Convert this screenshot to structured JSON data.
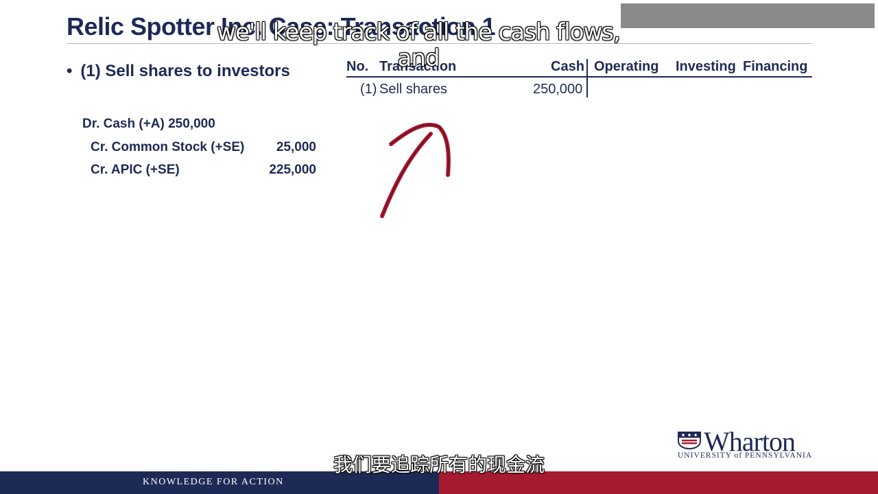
{
  "slide": {
    "title": "Relic Spotter Inc. Case: Transaction 1",
    "bullet": "(1) Sell shares to investors",
    "bullet_marker": "•"
  },
  "journal_entry": {
    "debit_label": "Dr. Cash (+A) 250,000",
    "credit_1_label": "Cr. Common Stock (+SE)",
    "credit_1_amount": "25,000",
    "credit_2_label": "Cr. APIC (+SE)",
    "credit_2_amount": "225,000"
  },
  "cash_flow_table": {
    "headers": {
      "no": "No.",
      "transaction": "Transaction",
      "cash": "Cash",
      "operating": "Operating",
      "investing": "Investing",
      "financing": "Financing"
    },
    "rows": [
      {
        "no": "(1)",
        "transaction": "Sell shares",
        "cash": "250,000",
        "operating": "",
        "investing": "",
        "financing": ""
      }
    ]
  },
  "annotation": {
    "icon": "hand-drawn-arrow-icon",
    "color": "#a61b2f"
  },
  "captions": {
    "english": "we'll keep track of all the cash flows, and",
    "chinese": "我们要追踪所有的现金流"
  },
  "branding": {
    "logo_name": "Wharton",
    "logo_subtitle": "UNIVERSITY of PENNSYLVANIA",
    "footer_tagline": "KNOWLEDGE FOR ACTION",
    "navy": "#1e2a56",
    "red": "#a61b2f"
  }
}
